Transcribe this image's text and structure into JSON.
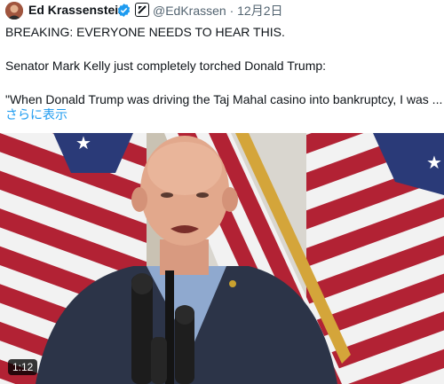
{
  "tweet": {
    "author_name": "Ed Krassenstein",
    "handle_date": "@EdKrassen · 12月2日",
    "line1": "BREAKING: EVERYONE NEEDS TO HEAR THIS.",
    "line2": "Senator Mark Kelly just completely torched Donald Trump:",
    "line3": "\"When Donald Trump was driving the Taj Mahal casino into bankruptcy, I was ...",
    "show_more": "さらに表示"
  },
  "media": {
    "duration": "1:12",
    "type": "video"
  },
  "icons": {
    "verified": "verified-badge-icon",
    "affiliation": "affiliation-badge-icon"
  },
  "colors": {
    "link": "#1d9bf0",
    "verified": "#1d9bf0",
    "text": "#0f1419",
    "muted": "#536471"
  }
}
